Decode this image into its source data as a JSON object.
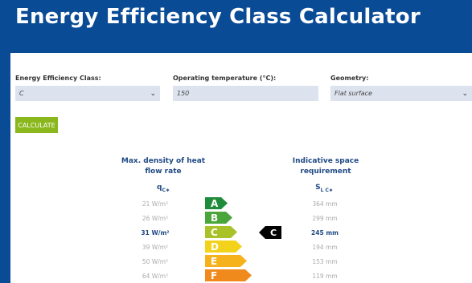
{
  "title": "Energy Efficiency Class Calculator",
  "form": {
    "class_label": "Energy Efficiency Class:",
    "class_value": "C",
    "temp_label": "Operating temperature (°C):",
    "temp_value": "150",
    "geometry_label": "Geometry:",
    "geometry_value": "Flat surface",
    "button": "CALCULATE"
  },
  "table": {
    "left_header_line1": "Max. density of heat",
    "left_header_line2": "flow rate",
    "left_symbol": "q",
    "left_symbol_sub": "C∗",
    "right_header_line1": "Indicative space",
    "right_header_line2": "requirement",
    "right_symbol": "S",
    "right_symbol_sub": "L C∗",
    "selected_class": "C",
    "rows": [
      {
        "cls": "A",
        "q": "21 W/m²",
        "s": "364 mm",
        "color": "#1e8c3a"
      },
      {
        "cls": "B",
        "q": "26 W/m²",
        "s": "299 mm",
        "color": "#4aa53a"
      },
      {
        "cls": "C",
        "q": "31 W/m²",
        "s": "245 mm",
        "color": "#a9c228"
      },
      {
        "cls": "D",
        "q": "39 W/m²",
        "s": "194 mm",
        "color": "#f2d21a"
      },
      {
        "cls": "E",
        "q": "50 W/m²",
        "s": "153 mm",
        "color": "#f5b21c"
      },
      {
        "cls": "F",
        "q": "64 W/m²",
        "s": "119 mm",
        "color": "#f08a1d"
      }
    ]
  }
}
